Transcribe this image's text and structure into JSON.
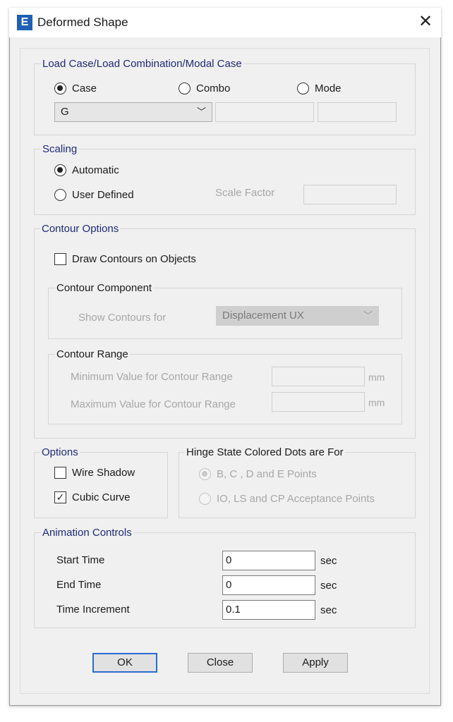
{
  "window": {
    "title": "Deformed Shape",
    "app_icon_letter": "E"
  },
  "load_case": {
    "legend": "Load Case/Load Combination/Modal Case",
    "options": [
      {
        "label": "Case",
        "checked": true
      },
      {
        "label": "Combo",
        "checked": false
      },
      {
        "label": "Mode",
        "checked": false
      }
    ],
    "selected_case": "G",
    "combo_value": "",
    "mode_value": ""
  },
  "scaling": {
    "legend": "Scaling",
    "automatic_label": "Automatic",
    "user_defined_label": "User Defined",
    "selected": "Automatic",
    "scale_factor_label": "Scale Factor",
    "scale_factor_value": ""
  },
  "contour_options": {
    "legend": "Contour Options",
    "draw_contours_label": "Draw Contours on Objects",
    "draw_contours_checked": false,
    "component": {
      "legend": "Contour Component",
      "show_for_label": "Show Contours for",
      "show_for_value": "Displacement UX"
    },
    "range": {
      "legend": "Contour Range",
      "min_label": "Minimum Value for Contour Range",
      "max_label": "Maximum Value for Contour Range",
      "min_value": "",
      "max_value": "",
      "unit": "mm"
    }
  },
  "options": {
    "legend": "Options",
    "wire_shadow_label": "Wire Shadow",
    "wire_shadow_checked": false,
    "cubic_curve_label": "Cubic Curve",
    "cubic_curve_checked": true
  },
  "hinge": {
    "legend": "Hinge State Colored Dots are For",
    "bcde_label": "B, C , D and E Points",
    "acceptance_label": "IO, LS and CP Acceptance Points",
    "selected": "B, C , D and E Points"
  },
  "animation": {
    "legend": "Animation Controls",
    "start_label": "Start Time",
    "start_value": "0",
    "end_label": "End Time",
    "end_value": "0",
    "increment_label": "Time Increment",
    "increment_value": "0.1",
    "unit": "sec"
  },
  "buttons": {
    "ok": "OK",
    "close": "Close",
    "apply": "Apply"
  },
  "icons": {
    "close": "close-icon",
    "dropdown": "chevron-down-icon"
  }
}
